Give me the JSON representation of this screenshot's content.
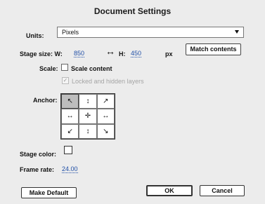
{
  "dialog": {
    "title": "Document Settings"
  },
  "units": {
    "label": "Units:",
    "selected": "Pixels"
  },
  "stage_size": {
    "label": "Stage size:",
    "width_label": "W:",
    "width_value": "850",
    "height_label": "H:",
    "height_value": "450",
    "unit": "px",
    "link_icon": "↔",
    "match_button": "Match contents"
  },
  "scale": {
    "label": "Scale:",
    "scale_content": "Scale content",
    "scale_content_checked": false,
    "locked_hidden": "Locked and hidden layers",
    "locked_hidden_checked": true,
    "check_mark": "✓"
  },
  "anchor": {
    "label": "Anchor:",
    "cells": [
      "↖",
      "↕",
      "↗",
      "↔",
      "✛",
      "↔",
      "↙",
      "↕",
      "↘"
    ],
    "selected_index": 0
  },
  "stage_color": {
    "label": "Stage color:",
    "color": "#ffffff"
  },
  "frame_rate": {
    "label": "Frame rate:",
    "value": "24.00"
  },
  "buttons": {
    "make_default": "Make Default",
    "ok": "OK",
    "cancel": "Cancel"
  }
}
